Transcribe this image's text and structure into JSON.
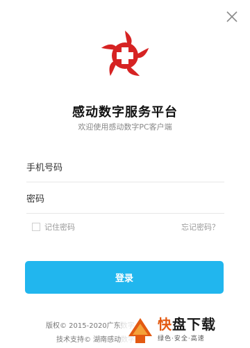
{
  "app": {
    "title": "感动数字服务平台",
    "subtitle": "欢迎使用感动数字PC客户端"
  },
  "form": {
    "phone_placeholder": "手机号码",
    "password_placeholder": "密码",
    "remember_label": "记住密码",
    "forgot_label": "忘记密码？",
    "login_label": "登录"
  },
  "footer": {
    "copyright": "版权© 2015-2020广东数字",
    "support": "技术支持© 湖南感动数字"
  },
  "watermark": {
    "main_prefix": "快",
    "main_rest": "盘下载",
    "tagline": "绿色·安全·高速"
  },
  "colors": {
    "accent": "#21b6ee",
    "brand_red": "#d62323",
    "watermark_orange": "#e35a12"
  },
  "icons": {
    "close": "close-icon",
    "logo": "medical-cross-logo"
  }
}
